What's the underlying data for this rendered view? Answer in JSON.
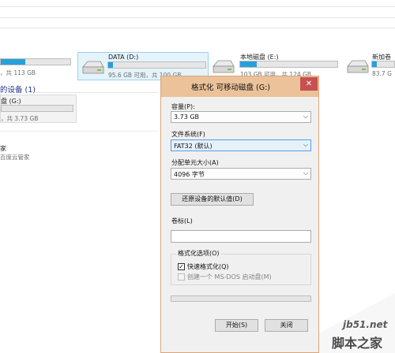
{
  "drives": [
    {
      "name": "",
      "info": "，共 113 GB",
      "fill_pct": 0.35
    },
    {
      "name": "DATA (D:)",
      "info": "95.6 GB 可用，共 100 GB",
      "fill_pct": 0.05
    },
    {
      "name": "本地磁盘 (E:)",
      "info": "103 GB 可用，共 124 GB",
      "fill_pct": 0.17
    },
    {
      "name": "新加卷",
      "info": "83.7 G",
      "fill_pct": 0.2
    }
  ],
  "removable_section": "的设备 (1)",
  "removable_drive": {
    "name": "盘 (G:)",
    "info": "，共 3.73 GB",
    "fill_pct": 0.0
  },
  "network_location": {
    "name": "家",
    "sub": "百度云管家"
  },
  "dialog": {
    "title": "格式化 可移动磁盘 (G:)",
    "close_glyph": "✕",
    "capacity_label": "容量(P):",
    "capacity_value": "3.73 GB",
    "fs_label": "文件系统(F)",
    "fs_value": "FAT32 (默认)",
    "alloc_label": "分配单元大小(A)",
    "alloc_value": "4096 字节",
    "restore_button": "还原设备的默认值(D)",
    "volume_label": "卷标(L)",
    "volume_value": "",
    "options_legend": "格式化选项(O)",
    "quick_format_label": "快速格式化(Q)",
    "quick_format_checked": true,
    "msdos_label": "创建一个 MS-DOS 启动盘(M)",
    "msdos_checked": false,
    "progress": 0,
    "start_button": "开始(S)",
    "close_button": "关闭"
  },
  "watermark": {
    "line1": "jb51.net",
    "line2": "脚本之家"
  },
  "icons": {
    "drive": "hard-drive-icon",
    "dropdown": "chevron-down-icon",
    "check": "checkmark-icon"
  }
}
